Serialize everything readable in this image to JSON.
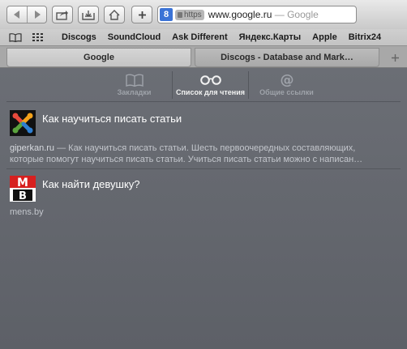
{
  "toolbar": {
    "secure_label": "https",
    "url_host": "www.google.ru",
    "url_suffix": "— Google",
    "favicon_letter": "8"
  },
  "bookmarks": [
    "Discogs",
    "SoundCloud",
    "Ask Different",
    "Яндекс.Карты",
    "Apple",
    "Bitrix24"
  ],
  "tabs": [
    {
      "label": "Google",
      "active": true
    },
    {
      "label": "Discogs - Database and Mark…",
      "active": false
    }
  ],
  "sidebar": {
    "segments": [
      {
        "label": "Закладки",
        "icon": "book-icon"
      },
      {
        "label": "Список для чтения",
        "icon": "glasses-icon",
        "selected": true
      },
      {
        "label": "Общие ссылки",
        "icon": "at-icon"
      }
    ],
    "items": [
      {
        "title": "Как научиться писать статьи",
        "site": "giperkan.ru",
        "snippet_line1": " — Как научиться писать статьи. Шесть первоочередных составляющих,",
        "snippet_line2": "которые помогут научиться писать статьи. Учиться писать статьи можно с написан…",
        "favicon": "joomla-favicon"
      },
      {
        "title": "Как найти девушку?",
        "site": "mens.by",
        "favicon": "mb-favicon",
        "favicon_text": "MB"
      }
    ]
  },
  "colors": {
    "sidebar_bg": "#63666d",
    "accent_blue": "#3b73d6"
  }
}
